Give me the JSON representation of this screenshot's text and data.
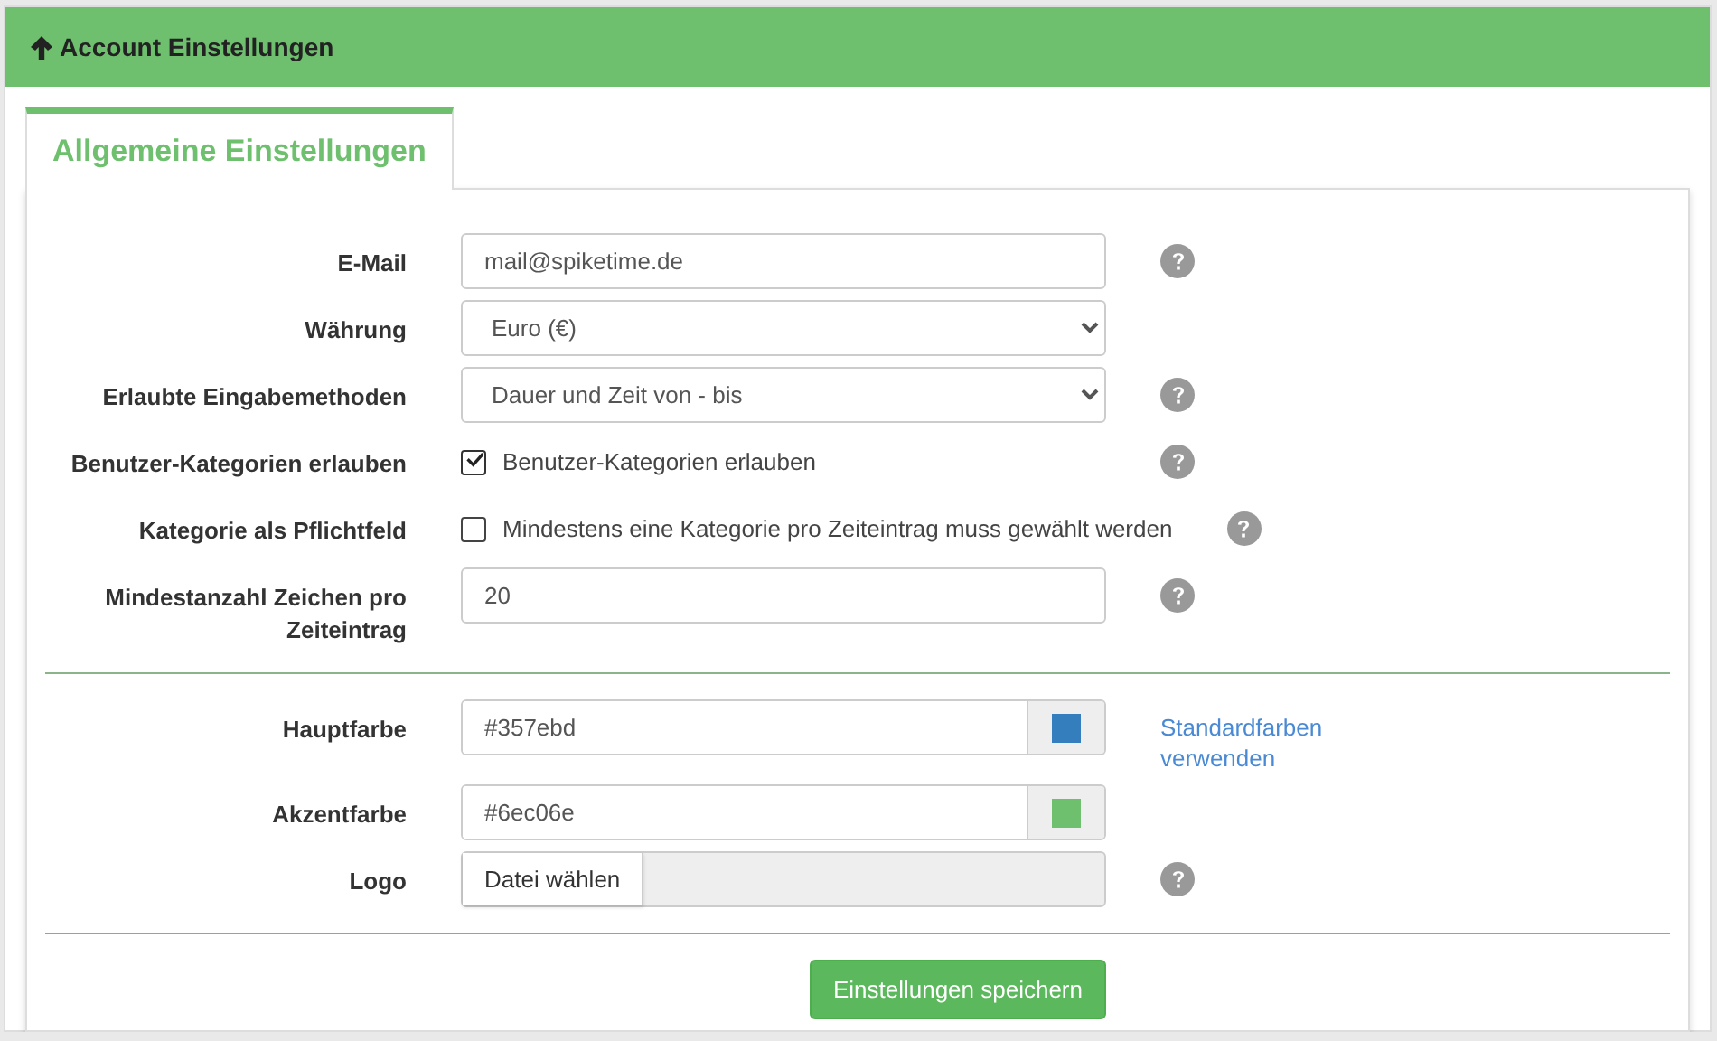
{
  "header": {
    "title": "Account Einstellungen"
  },
  "tabs": [
    {
      "label": "Allgemeine Einstellungen",
      "selected": true
    }
  ],
  "sections": [
    {
      "rows": [
        {
          "kind": "text",
          "label": "E-Mail",
          "value": "mail@spiketime.de",
          "help": true
        },
        {
          "kind": "select",
          "label": "Währung",
          "value": "Euro (€)",
          "help": false
        },
        {
          "kind": "select",
          "label": "Erlaubte Eingabemethoden",
          "value": "Dauer und Zeit von - bis",
          "help": true
        },
        {
          "kind": "checkbox",
          "label": "Benutzer-Kategorien erlauben",
          "text": "Benutzer-Kategorien erlauben",
          "checked": true,
          "help": true
        },
        {
          "kind": "checkbox",
          "label": "Kategorie als Pflichtfeld",
          "text": "Mindestens eine Kategorie pro Zeiteintrag muss gewählt werden",
          "checked": false,
          "help": true
        },
        {
          "kind": "text",
          "label": "Mindestanzahl Zeichen pro Zeiteintrag",
          "value": "20",
          "help": true
        }
      ]
    },
    {
      "rows": [
        {
          "kind": "color",
          "label": "Hauptfarbe",
          "value": "#357ebd",
          "color": "#357ebd",
          "help": false,
          "link": "Standardfarben verwenden"
        },
        {
          "kind": "color",
          "label": "Akzentfarbe",
          "value": "#6ec06e",
          "color": "#6ec06e",
          "help": false
        },
        {
          "kind": "file",
          "label": "Logo",
          "button": "Datei wählen",
          "help": true
        }
      ]
    }
  ],
  "save_button": "Einstellungen speichern"
}
